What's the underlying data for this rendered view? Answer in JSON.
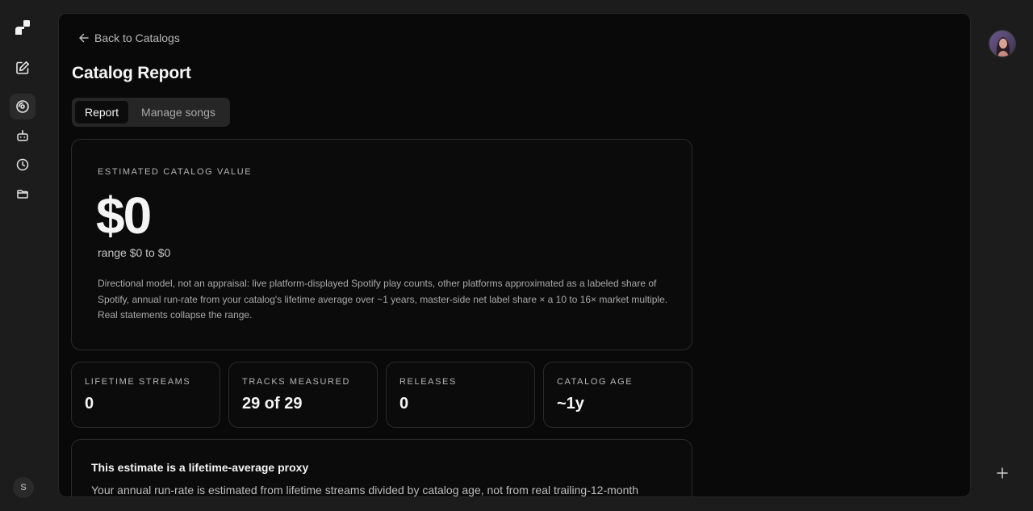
{
  "sidebar": {
    "items": [
      {
        "name": "logo",
        "icon": "brand-logo-icon"
      },
      {
        "name": "new-chat",
        "icon": "edit-square-icon"
      },
      {
        "name": "catalogs",
        "icon": "record-disc-icon",
        "active": true
      },
      {
        "name": "agents",
        "icon": "robot-icon"
      },
      {
        "name": "history",
        "icon": "clock-icon"
      },
      {
        "name": "files",
        "icon": "folder-icon"
      }
    ],
    "user_initial": "S"
  },
  "header": {
    "back_label": "Back to Catalogs",
    "title": "Catalog Report"
  },
  "tabs": [
    {
      "label": "Report",
      "active": true
    },
    {
      "label": "Manage songs",
      "active": false
    }
  ],
  "valuation": {
    "eyebrow": "ESTIMATED CATALOG VALUE",
    "value": "$0",
    "range": "range $0 to $0",
    "description": "Directional model, not an appraisal: live platform-displayed Spotify play counts, other platforms approximated as a labeled share of Spotify, annual run-rate from your catalog's lifetime average over ~1 years, master-side net label share × a 10 to 16× market multiple. Real statements collapse the range."
  },
  "stats": [
    {
      "label": "LIFETIME STREAMS",
      "value": "0"
    },
    {
      "label": "TRACKS MEASURED",
      "value": "29 of 29"
    },
    {
      "label": "RELEASES",
      "value": "0"
    },
    {
      "label": "CATALOG AGE",
      "value": "~1y"
    }
  ],
  "notice": {
    "title": "This estimate is a lifetime-average proxy",
    "body": "Your annual run-rate is estimated from lifetime streams divided by catalog age, not from real trailing-12-month"
  },
  "right_rail": {
    "avatar": "user-avatar",
    "add_icon": "plus-icon"
  },
  "colors": {
    "app_bg": "#1c1c1c",
    "panel_bg": "#090909",
    "card_border": "#2a2a2a",
    "text_primary": "#f5f5f5",
    "text_muted": "#a9a9a9"
  }
}
